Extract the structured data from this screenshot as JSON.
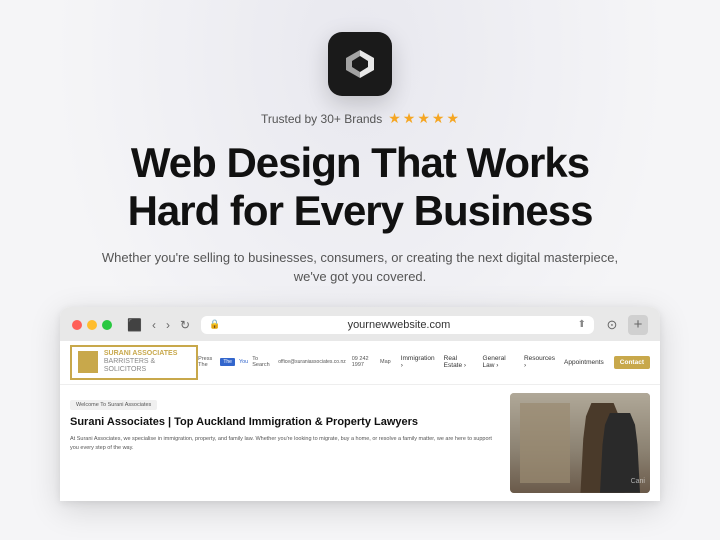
{
  "logo": {
    "alt": "Craftwork logo"
  },
  "trusted": {
    "text": "Trusted by 30+ Brands",
    "stars": [
      "★",
      "★",
      "★",
      "★",
      "★"
    ]
  },
  "headline": {
    "line1": "Web Design That Works",
    "line2": "Hard for Every Business"
  },
  "subheadline": {
    "text": "Whether you're selling to businesses, consumers, or creating the next digital masterpiece, we've got you covered."
  },
  "browser": {
    "url": "yournewwebsite.com",
    "tab_icon": "🌐",
    "buttons": {
      "back": "‹",
      "forward": "›",
      "refresh": "↻",
      "share": "⎋",
      "add_tab": "+"
    }
  },
  "website": {
    "logo_name": "SURANI ASSOCIATES",
    "logo_sub": "Barristers & Solicitors",
    "nav_links": [
      "Immigration",
      "Real Estate",
      "General Law",
      "Resources",
      "Appointments"
    ],
    "contact_label": "Contact",
    "press_label": "Press The",
    "phone": "09 242 1997",
    "map": "Map",
    "email": "office@suraniassociates.co.nz",
    "welcome_badge": "Welcome To Surani Associates",
    "hero_title": "Surani Associates | Top Auckland Immigration & Property Lawyers",
    "hero_body": "At Surani Associates, we specialise in immigration, property, and family law. Whether you're looking to migrate, buy a home, or resolve a family matter, we are here to support you every step of the way.",
    "cani_text": "Cani"
  }
}
